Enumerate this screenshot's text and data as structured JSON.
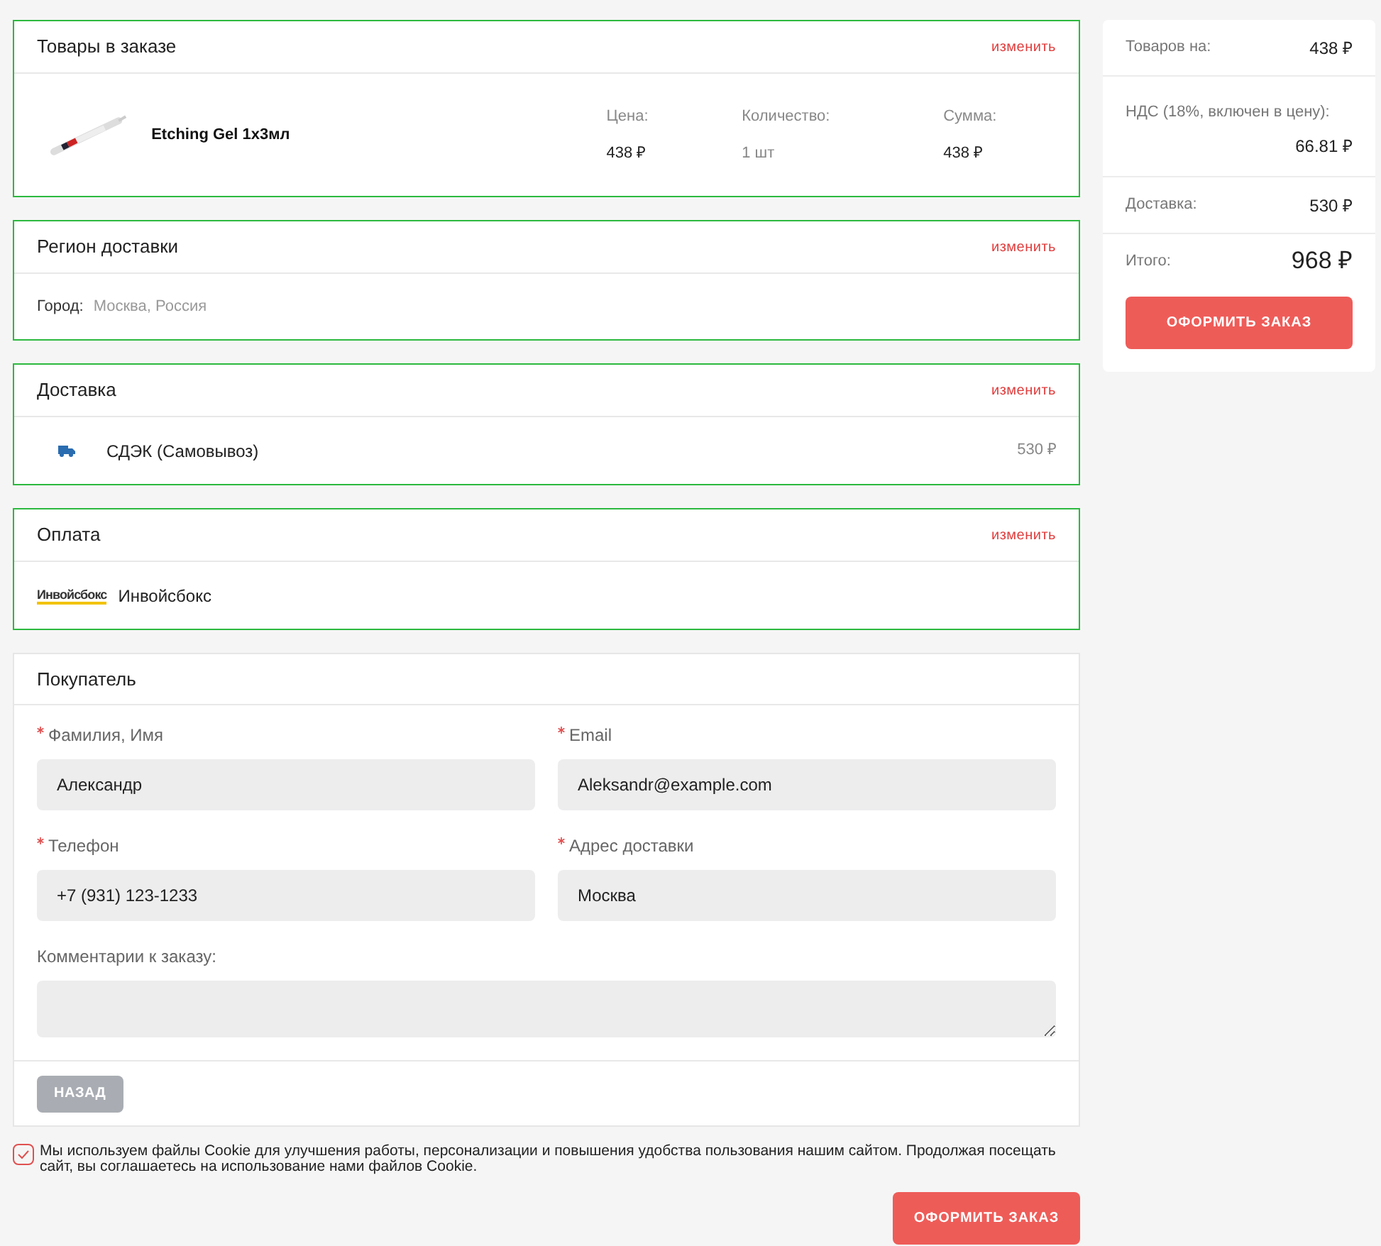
{
  "cart": {
    "title": "Товары в заказе",
    "edit": "изменить",
    "item": {
      "kind": "picture",
      "name": "Etching Gel 1x3мл",
      "price_label": "Цена:",
      "price": "438 ₽",
      "qty_label": "Количество:",
      "qty": "1 шт",
      "sum_label": "Сумма:",
      "sum": "438 ₽"
    }
  },
  "region": {
    "title": "Регион доставки",
    "edit": "изменить",
    "city_label": "Город:",
    "city": "Москва, Россия"
  },
  "delivery": {
    "title": "Доставка",
    "edit": "изменить",
    "method": "СДЭК (Самовывоз)",
    "price": "530 ₽"
  },
  "payment": {
    "title": "Оплата",
    "edit": "изменить",
    "logo": "Инвойсбокс",
    "method": "Инвойсбокс"
  },
  "buyer": {
    "title": "Покупатель",
    "fields": [
      {
        "kind": "input",
        "label": "Фамилия, Имя",
        "required": true,
        "value": "Александр"
      },
      {
        "kind": "input",
        "label": "Email",
        "required": true,
        "value": "Aleksandr@example.com"
      },
      {
        "kind": "input",
        "label": "Телефон",
        "required": true,
        "value": "+7 (931) 123-1233"
      },
      {
        "kind": "input",
        "label": "Адрес доставки",
        "required": true,
        "value": "Москва"
      },
      {
        "kind": "textarea",
        "label": "Комментарии к заказу:",
        "required": false
      }
    ],
    "back": "НАЗАД"
  },
  "cookie": {
    "checked": true,
    "text": "Мы используем файлы Cookie для улучшения работы, персонализации и повышения удобства пользования нашим сайтом. Продолжая посещать сайт, вы соглашаетесь на использование нами файлов Cookie."
  },
  "submit": "ОФОРМИТЬ ЗАКАЗ",
  "summary": {
    "rows": [
      {
        "kind": "inline",
        "label": "Товаров на:",
        "value": "438 ₽"
      },
      {
        "kind": "stacked",
        "label": "НДС (18%, включен в цену):",
        "value": "66.81 ₽"
      },
      {
        "kind": "inline",
        "label": "Доставка:",
        "value": "530 ₽"
      },
      {
        "kind": "total",
        "label": "Итого:",
        "value": "968 ₽"
      }
    ],
    "submit": "ОФОРМИТЬ ЗАКАЗ"
  }
}
